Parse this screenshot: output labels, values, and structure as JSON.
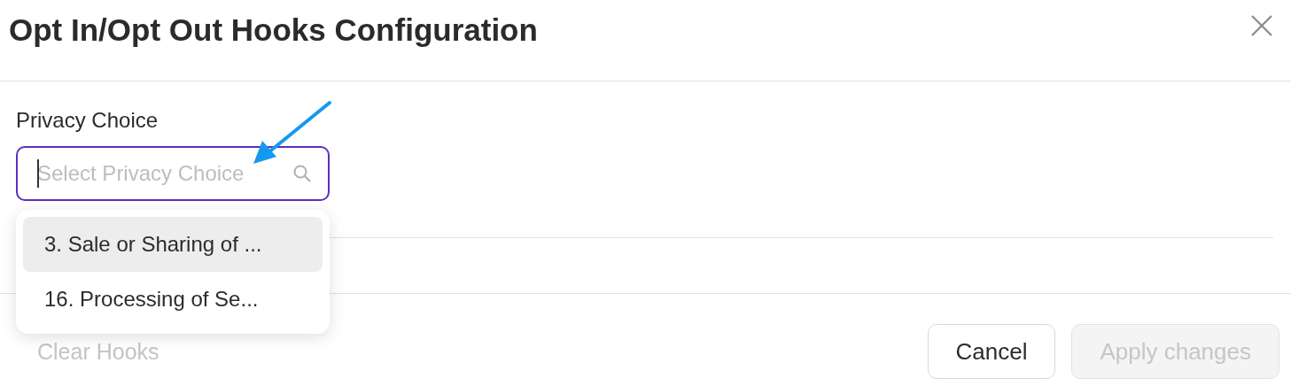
{
  "dialog": {
    "title": "Opt In/Opt Out Hooks Configuration"
  },
  "privacy_choice": {
    "label": "Privacy Choice",
    "placeholder": "Select Privacy Choice",
    "focused": true,
    "options": [
      {
        "label": "3. Sale or Sharing of ...",
        "selected": true
      },
      {
        "label": "16. Processing of Se...",
        "selected": false
      }
    ]
  },
  "footer": {
    "clear_link": {
      "label": "Clear Hooks",
      "disabled": true
    },
    "buttons": [
      {
        "label": "Cancel",
        "kind": "secondary",
        "disabled": false
      },
      {
        "label": "Apply changes",
        "kind": "primary",
        "disabled": true
      }
    ]
  }
}
